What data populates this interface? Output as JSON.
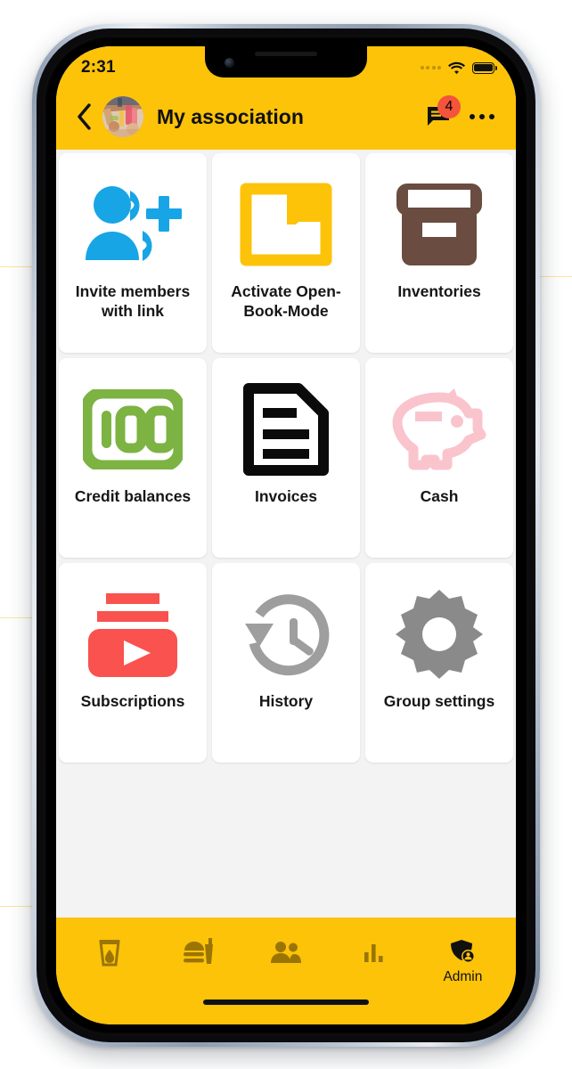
{
  "theme": {
    "brand_yellow": "#FCC309",
    "page_bg": "#F3F3F3",
    "tile_bg": "#FFFFFF",
    "badge_red": "#F4543B",
    "text_dark": "#161616",
    "nav_icon_inactive": "#9A7505",
    "nav_icon_active": "#111111"
  },
  "status_bar": {
    "time": "2:31",
    "cellular_icon": "cellular-dots-icon",
    "wifi_icon": "wifi-icon",
    "battery_icon": "battery-full-icon"
  },
  "app_bar": {
    "back_icon": "chevron-left-icon",
    "avatar_icon": "group-photo-avatar",
    "title": "My association",
    "chat_icon": "chat-bubble-icon",
    "chat_badge_count": "4",
    "more_icon": "overflow-menu-icon"
  },
  "grid": {
    "tiles": [
      {
        "label": "Invite members with link",
        "icon": "person-add-icon",
        "icon_color": "#17A5E6"
      },
      {
        "label": "Activate Open-Book-Mode",
        "icon": "folder-open-icon",
        "icon_color": "#FCC309"
      },
      {
        "label": "Inventories",
        "icon": "archive-box-icon",
        "icon_color": "#6A4C41"
      },
      {
        "label": "Credit balances",
        "icon": "credit-100-icon",
        "icon_color": "#7CB342"
      },
      {
        "label": "Invoices",
        "icon": "document-lines-icon",
        "icon_color": "#0A0A0A"
      },
      {
        "label": "Cash",
        "icon": "piggy-bank-icon",
        "icon_color": "#FAC4CD"
      },
      {
        "label": "Subscriptions",
        "icon": "subscriptions-play-icon",
        "icon_color": "#F9524F"
      },
      {
        "label": "History",
        "icon": "history-clock-icon",
        "icon_color": "#9E9E9E"
      },
      {
        "label": "Group settings",
        "icon": "gear-icon",
        "icon_color": "#8A8A8A"
      }
    ]
  },
  "bottom_nav": {
    "items": [
      {
        "label": "",
        "icon": "drink-glass-icon",
        "active": false
      },
      {
        "label": "",
        "icon": "fastfood-icon",
        "active": false
      },
      {
        "label": "",
        "icon": "people-group-icon",
        "active": false
      },
      {
        "label": "",
        "icon": "bar-chart-icon",
        "active": false
      },
      {
        "label": "Admin",
        "icon": "admin-shield-icon",
        "active": true
      }
    ]
  }
}
